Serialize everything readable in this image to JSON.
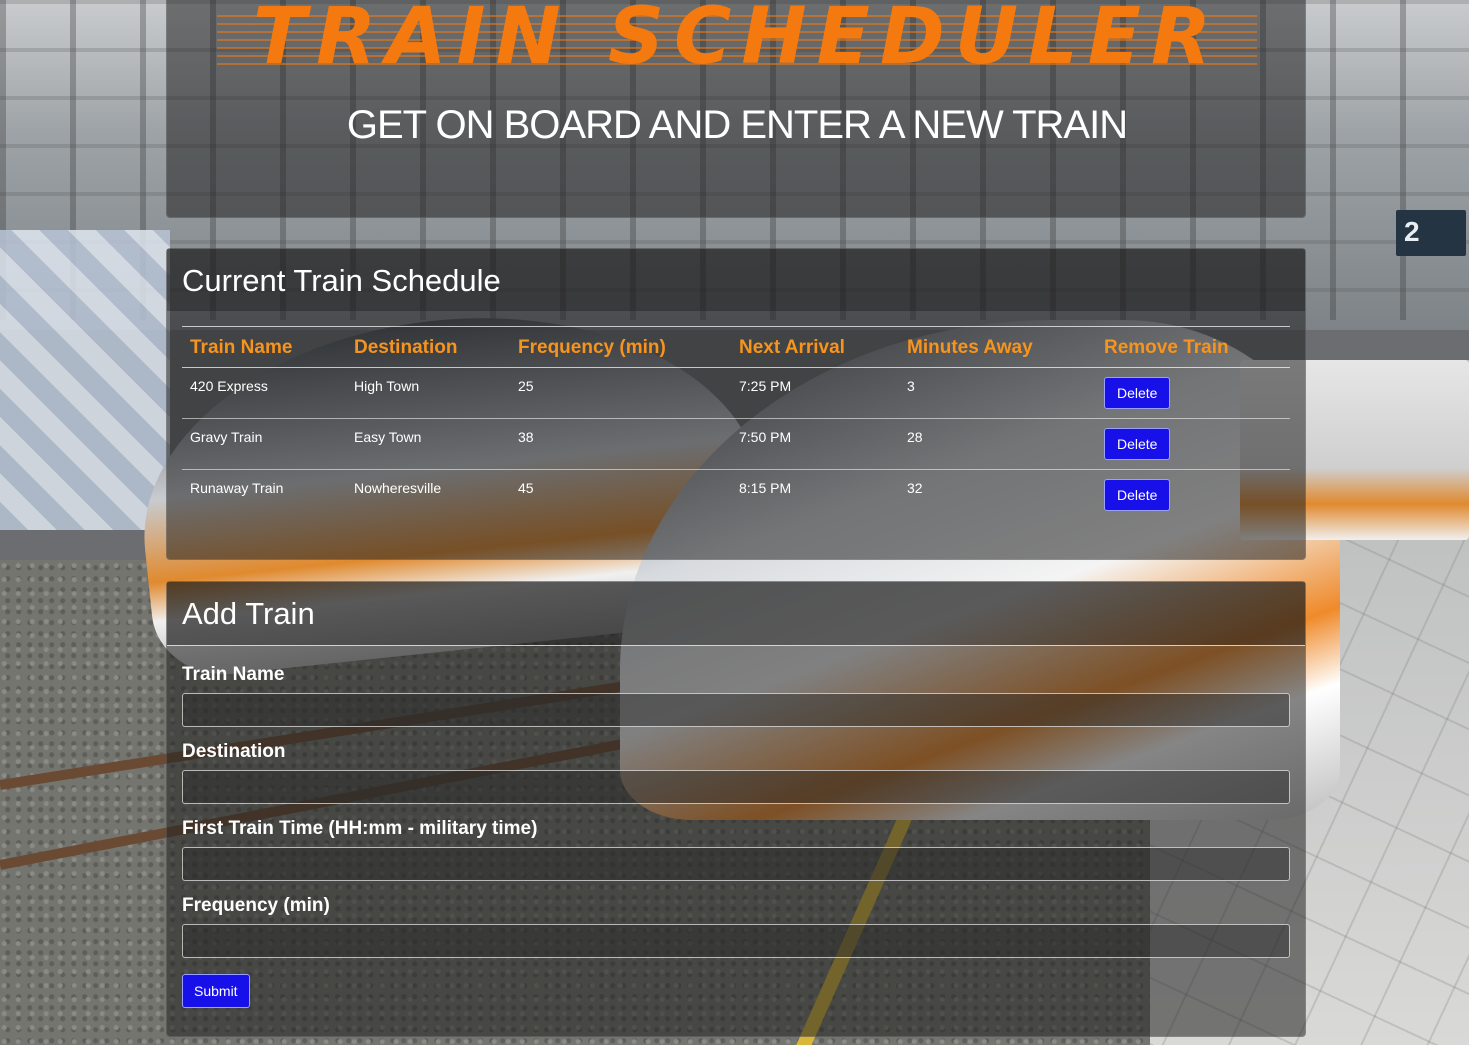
{
  "header": {
    "logo_text": "TRAIN SCHEDULER",
    "tagline": "GET ON BOARD AND ENTER A NEW TRAIN"
  },
  "schedule": {
    "title": "Current Train Schedule",
    "columns": [
      "Train Name",
      "Destination",
      "Frequency (min)",
      "Next Arrival",
      "Minutes Away",
      "Remove Train"
    ],
    "rows": [
      {
        "name": "420 Express",
        "destination": "High Town",
        "frequency": "25",
        "next_arrival": "7:25 PM",
        "minutes_away": "3",
        "action": "Delete"
      },
      {
        "name": "Gravy Train",
        "destination": "Easy Town",
        "frequency": "38",
        "next_arrival": "7:50 PM",
        "minutes_away": "28",
        "action": "Delete"
      },
      {
        "name": "Runaway Train",
        "destination": "Nowheresville",
        "frequency": "45",
        "next_arrival": "8:15 PM",
        "minutes_away": "32",
        "action": "Delete"
      }
    ]
  },
  "add_train": {
    "title": "Add Train",
    "fields": {
      "name_label": "Train Name",
      "name_value": "",
      "destination_label": "Destination",
      "destination_value": "",
      "first_time_label": "First Train Time (HH:mm - military time)",
      "first_time_value": "",
      "frequency_label": "Frequency (min)",
      "frequency_value": ""
    },
    "submit_label": "Submit"
  },
  "background": {
    "platform_sign": "2"
  },
  "colors": {
    "accent_orange": "#f7941d",
    "logo_orange": "#f47a10",
    "button_blue": "#1710e8",
    "panel_bg": "rgba(32,32,32,0.55)"
  }
}
